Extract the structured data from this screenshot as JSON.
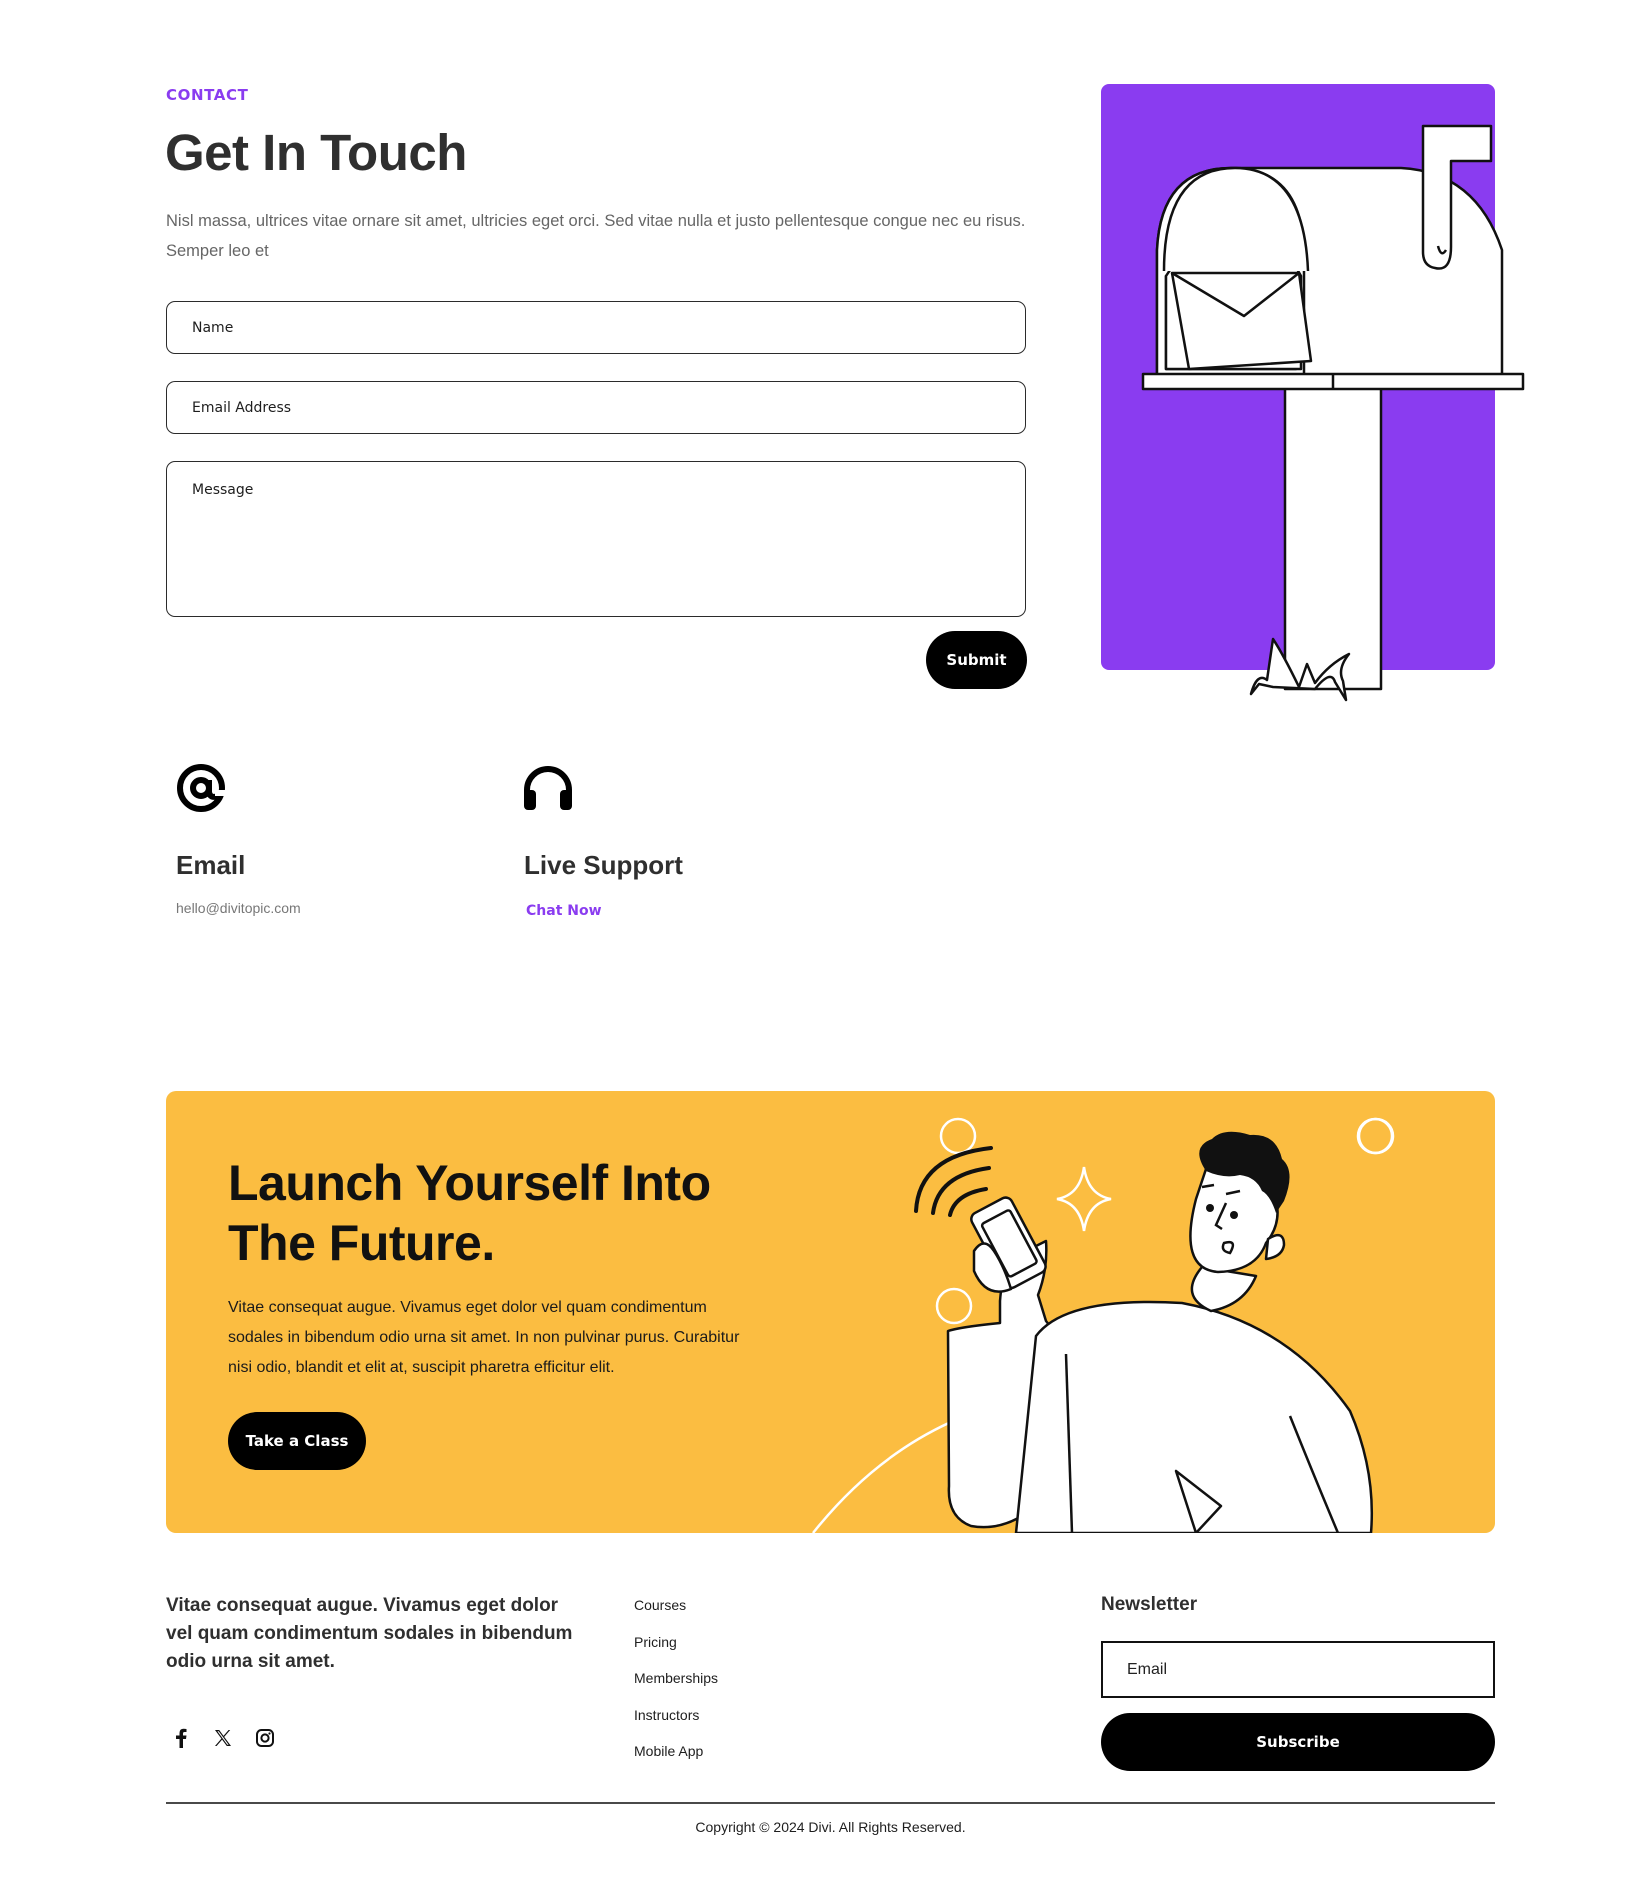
{
  "contact": {
    "eyebrow": "CONTACT",
    "title": "Get In Touch",
    "intro": "Nisl massa, ultrices vitae ornare sit amet, ultricies eget orci. Sed vitae nulla et justo pellentesque congue nec eu risus. Semper leo et",
    "form": {
      "name_placeholder": "Name",
      "email_placeholder": "Email Address",
      "message_placeholder": "Message",
      "submit_label": "Submit"
    }
  },
  "info": {
    "email": {
      "icon": "at-sign-icon",
      "title": "Email",
      "value": "hello@divitopic.com"
    },
    "support": {
      "icon": "headphones-icon",
      "title": "Live Support",
      "link_label": "Chat Now"
    }
  },
  "cta": {
    "title": "Launch Yourself Into The Future.",
    "text": "Vitae consequat augue. Vivamus eget dolor vel quam condimentum sodales in bibendum odio urna sit amet. In non pulvinar purus. Curabitur nisi odio, blandit et elit at, suscipit pharetra efficitur elit.",
    "button_label": "Take a Class"
  },
  "footer": {
    "blurb": "Vitae consequat augue. Vivamus eget dolor vel quam condimentum sodales in bibendum odio urna sit amet.",
    "social": [
      "facebook-icon",
      "x-twitter-icon",
      "instagram-icon"
    ],
    "links": [
      "Courses",
      "Pricing",
      "Memberships",
      "Instructors",
      "Mobile App"
    ],
    "newsletter": {
      "title": "Newsletter",
      "placeholder": "Email",
      "button_label": "Subscribe"
    },
    "copyright": "Copyright © 2024 Divi. All Rights Reserved."
  },
  "colors": {
    "accent": "#8a3cf0",
    "cta_bg": "#fbbd41",
    "button": "#000000"
  }
}
